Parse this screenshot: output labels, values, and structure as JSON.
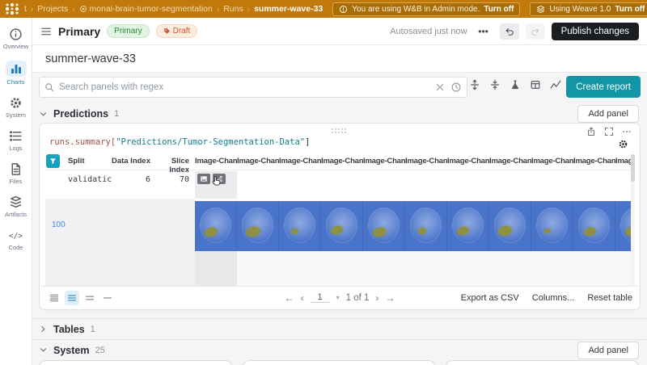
{
  "topbar": {
    "breadcrumb": [
      {
        "text": "t"
      },
      {
        "text": "Projects"
      },
      {
        "text": "monai-brain-tumor-segmentation",
        "icon": "project"
      },
      {
        "text": "Runs"
      },
      {
        "text": "summer-wave-33",
        "current": true
      }
    ],
    "admin_notice": "You are using W&B in Admin mode.",
    "admin_action": "Turn off",
    "weave_notice": "Using Weave 1.0",
    "weave_action": "Turn off"
  },
  "sidebar": {
    "items": [
      {
        "label": "Overview",
        "icon": "info",
        "active": false
      },
      {
        "label": "Charts",
        "icon": "charts",
        "active": true
      },
      {
        "label": "System",
        "icon": "gear",
        "active": false
      },
      {
        "label": "Logs",
        "icon": "logs",
        "active": false
      },
      {
        "label": "Files",
        "icon": "files",
        "active": false
      },
      {
        "label": "Artifacts",
        "icon": "artifacts",
        "active": false
      },
      {
        "label": "Code",
        "icon": "code",
        "active": false
      }
    ]
  },
  "header": {
    "title": "Primary",
    "badge_primary": "Primary",
    "badge_draft": "Draft",
    "autosaved": "Autosaved just now",
    "more_label": "•••",
    "publish": "Publish changes"
  },
  "run_title": "summer-wave-33",
  "search": {
    "placeholder": "Search panels with regex",
    "create_report": "Create report"
  },
  "sections": {
    "predictions": {
      "label": "Predictions",
      "count": "1",
      "add_panel": "Add panel"
    },
    "tables": {
      "label": "Tables",
      "count": "1"
    },
    "system": {
      "label": "System",
      "count": "25",
      "add_panel": "Add panel"
    }
  },
  "panel": {
    "code_prefix": "runs.summary[",
    "code_string": "\"Predictions/Tumor-Segmentation-Data\"",
    "code_suffix": "]",
    "table": {
      "columns": {
        "split": "Split",
        "data_index": "Data Index",
        "slice_index": "Slice Index"
      },
      "image_column_label": "Image-Channe",
      "image_column_count": 11,
      "row": {
        "split": "validatic",
        "data_index": "6",
        "slice_index": "70"
      },
      "media_step": "100",
      "footer": {
        "page": "1",
        "page_info": "1 of 1",
        "export_csv": "Export as CSV",
        "columns": "Columns...",
        "reset": "Reset table"
      }
    }
  },
  "icons": {
    "topbar": [
      "search-icon",
      "bell-icon",
      "help-icon",
      "avatar"
    ],
    "panel": [
      "share-icon",
      "fullscreen-icon",
      "more-icon",
      "gear-icon",
      "filter-funnel-icon"
    ]
  },
  "colors": {
    "topbar_orange": "#c2790b",
    "teal_accent": "#1296a5",
    "blue_accent": "#1f7bb6",
    "strip_blue": "#4a74c9",
    "tumor_olive": "#8e9143",
    "publish_black": "#1a1d21"
  }
}
